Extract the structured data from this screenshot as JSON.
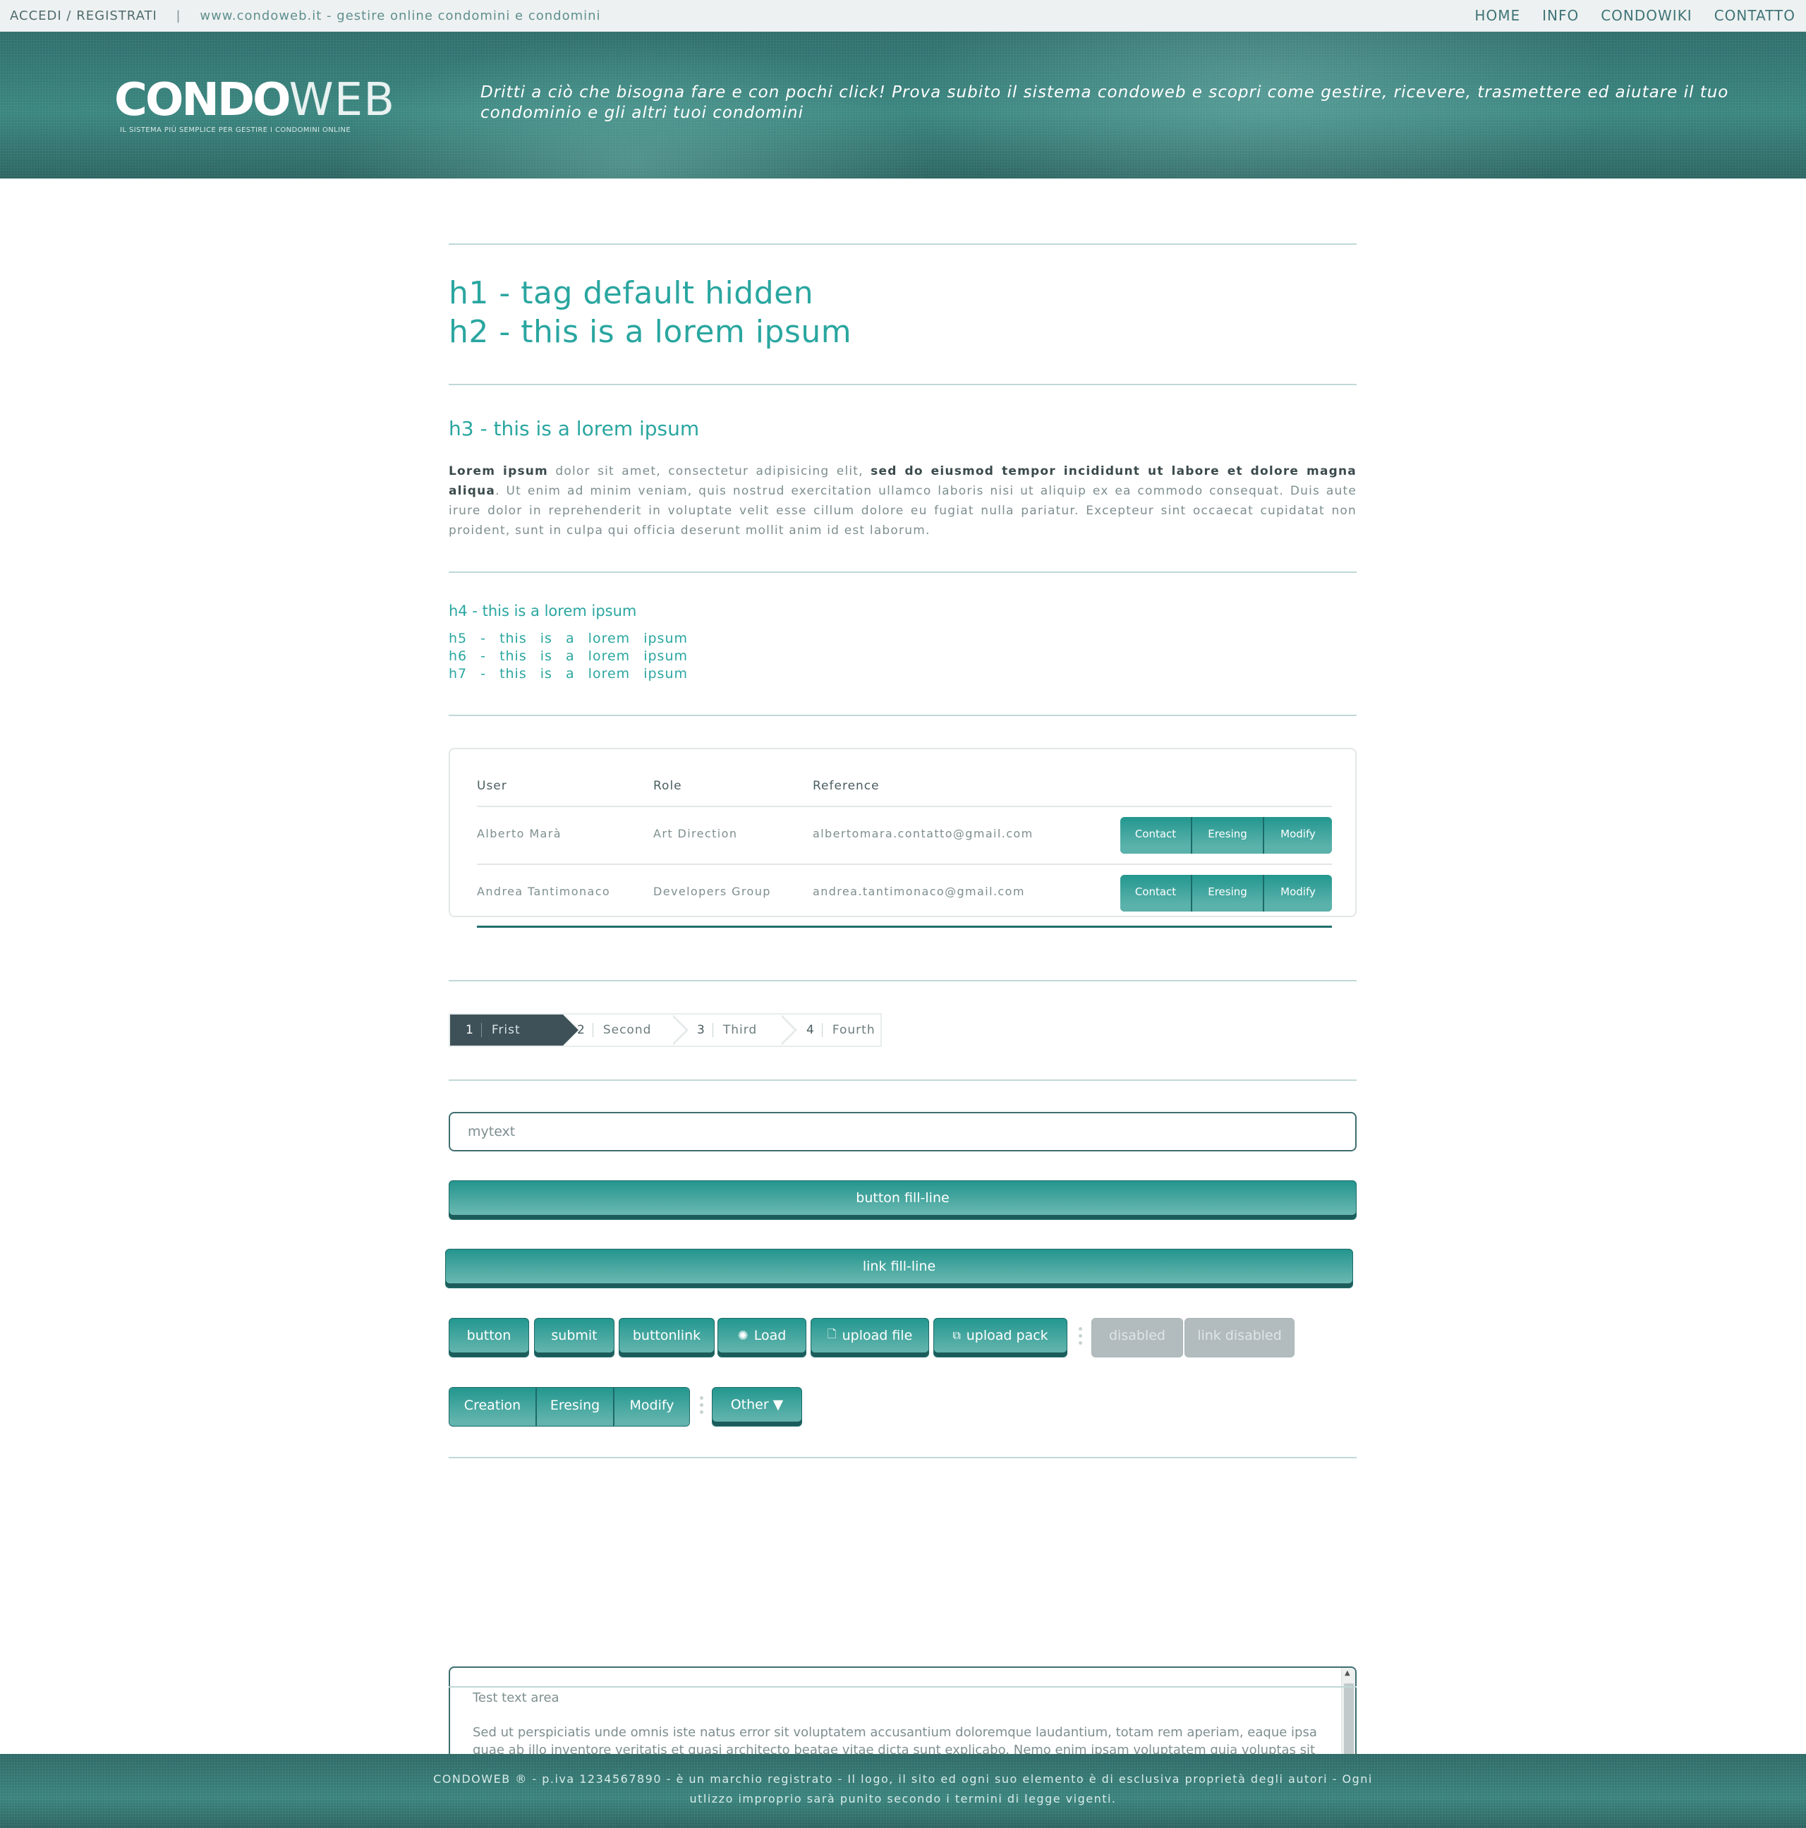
{
  "topbar": {
    "login": "ACCEDI",
    "slash": "/",
    "register": "REGISTRATI",
    "separator": "|",
    "site_text": "www.condoweb.it - gestire online condomini e condomini",
    "nav": [
      "HOME",
      "INFO",
      "CONDOWIKI",
      "CONTATTO"
    ]
  },
  "header": {
    "logo_condo": "CONDO",
    "logo_web": "WEB",
    "logo_tagline": "IL SISTEMA PIÙ SEMPLICE PER GESTIRE I CONDOMINI ONLINE",
    "claim": "Dritti a ciò che bisogna fare e con pochi click! Prova subito il sistema condoweb e scopri come gestire, ricevere, trasmettere ed aiutare il tuo condominio e gli altri tuoi condomini"
  },
  "headings": {
    "h1": "h1 - tag default hidden",
    "h2": "h2 - this is a lorem ipsum",
    "h3": "h3 - this is a lorem ipsum",
    "h4": "h4 - this is a lorem ipsum",
    "h5": "h5 - this is a lorem ipsum",
    "h6": "h6 - this is a lorem ipsum",
    "h7": "h7 - this is a lorem ipsum"
  },
  "paragraph": {
    "bold1": "Lorem ipsum",
    "text1": " dolor sit amet, consectetur adipisicing elit, ",
    "bold2": "sed do eiusmod tempor incididunt ut labore et dolore magna aliqua",
    "text2": ". Ut enim ad minim veniam, quis nostrud exercitation ullamco laboris nisi ut aliquip ex ea commodo consequat. Duis aute irure dolor in reprehenderit in voluptate velit esse cillum dolore eu fugiat nulla pariatur. Excepteur sint occaecat cupidatat non proident, sunt in culpa qui officia deserunt mollit anim id est laborum."
  },
  "table": {
    "headers": [
      "User",
      "Role",
      "Reference"
    ],
    "rows": [
      {
        "user": "Alberto Marà",
        "role": "Art Direction",
        "reference": "albertomara.contatto@gmail.com"
      },
      {
        "user": "Andrea Tantimonaco",
        "role": "Developers Group",
        "reference": "andrea.tantimonaco@gmail.com"
      }
    ],
    "actions": [
      "Contact",
      "Eresing",
      "Modify"
    ]
  },
  "stepper": [
    {
      "num": "1",
      "label": "Frist",
      "active": true
    },
    {
      "num": "2",
      "label": "Second",
      "active": false
    },
    {
      "num": "3",
      "label": "Third",
      "active": false
    },
    {
      "num": "4",
      "label": "Fourth",
      "active": false
    }
  ],
  "form": {
    "input_value": "mytext",
    "button_fill_line": "button fill-line",
    "link_fill_line": "link fill-line",
    "buttons": {
      "button": "button",
      "submit": "submit",
      "buttonlink": "buttonlink",
      "load": "Load",
      "upload_file": "upload file",
      "upload_pack": "upload pack",
      "disabled": "disabled",
      "link_disabled": "link disabled"
    },
    "segment": [
      "Creation",
      "Eresing",
      "Modify"
    ],
    "other": "Other ▼",
    "textarea_title": "Test text area",
    "textarea_body": "Sed ut perspiciatis unde omnis iste natus error sit voluptatem accusantium doloremque laudantium, totam rem aperiam, eaque ipsa quae ab illo inventore veritatis et quasi architecto beatae vitae dicta sunt explicabo. Nemo enim ipsam voluptatem quia voluptas sit aspernatur aut odit aut fugit, sed quia consequuntur magni dolores eos qui ratione voluptatem sequi nesciunt. Neque porro quisquam est, qui dolorem ipsum quia dolor sit amet, consectetur, adipisci velit, sed quia non numquam eius modi tempora incidunt ut labore et dolore magnam aliquam quaerat voluptatem."
  },
  "footer": {
    "text": "CONDOWEB ® - p.iva 1234567890 - è un marchio registrato - Il logo, il sito ed ogni suo elemento è di esclusiva proprietà degli autori - Ogni utlizzo improprio sarà punito secondo i termini di legge vigenti."
  },
  "colors": {
    "accent": "#2aa6a0",
    "button_top": "#23978f",
    "button_shadow": "#1c5c5b",
    "header_bg": "#3b8680",
    "step_active": "#3f5158",
    "disabled": "#b2bcbe"
  }
}
